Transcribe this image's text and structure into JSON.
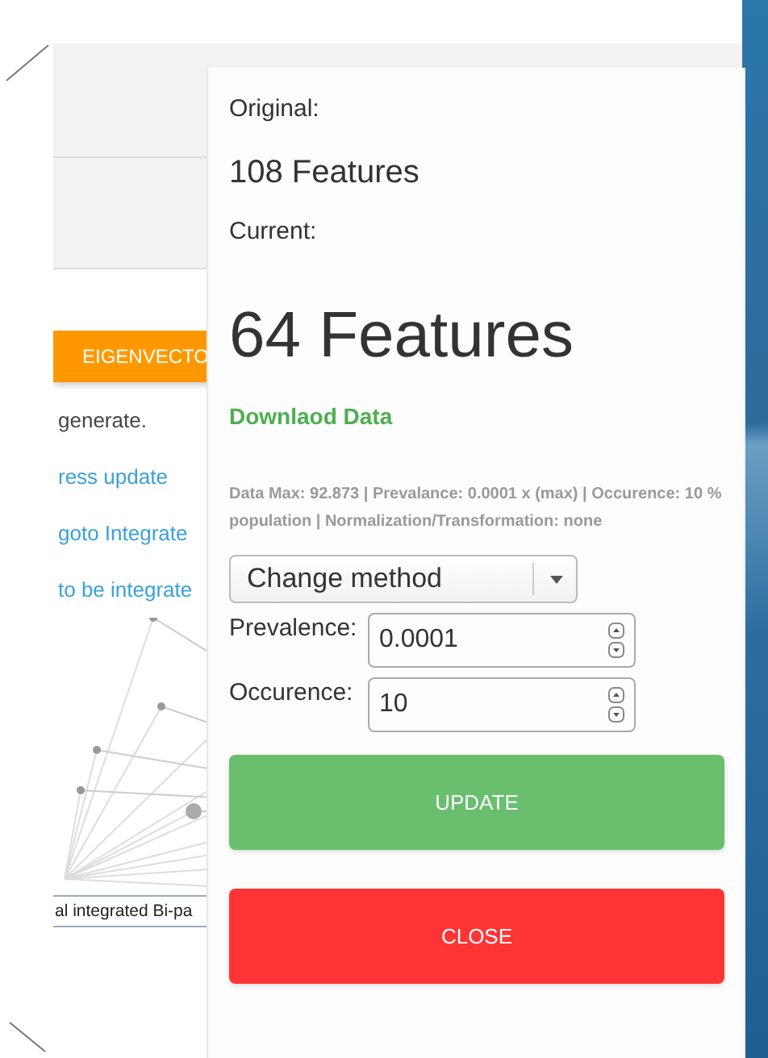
{
  "background_page": {
    "tab_button": "EIGENVECTO",
    "lines": [
      {
        "text": "generate.",
        "kind": "plain"
      },
      {
        "text": "ress update",
        "kind": "link"
      },
      {
        "text": "goto Integrate",
        "kind": "link"
      },
      {
        "text": "to be integrate",
        "kind": "link"
      }
    ],
    "graph_caption": "al integrated Bi-pa"
  },
  "dialog": {
    "original_label": "Original:",
    "original_value": "108 Features",
    "current_label": "Current:",
    "current_value": "64 Features",
    "download_link": "Downlaod Data",
    "info": "Data Max: 92.873 | Prevalance: 0.0001 x (max) | Occurence: 10 % population | Normalization/Transformation: none",
    "method_select": "Change method",
    "fields": [
      {
        "label": "Prevalence:",
        "value": "0.0001"
      },
      {
        "label": "Occurence:",
        "value": "10"
      }
    ],
    "buttons": [
      {
        "label": "UPDATE",
        "kind": "primary"
      },
      {
        "label": "CLOSE",
        "kind": "danger"
      }
    ]
  }
}
